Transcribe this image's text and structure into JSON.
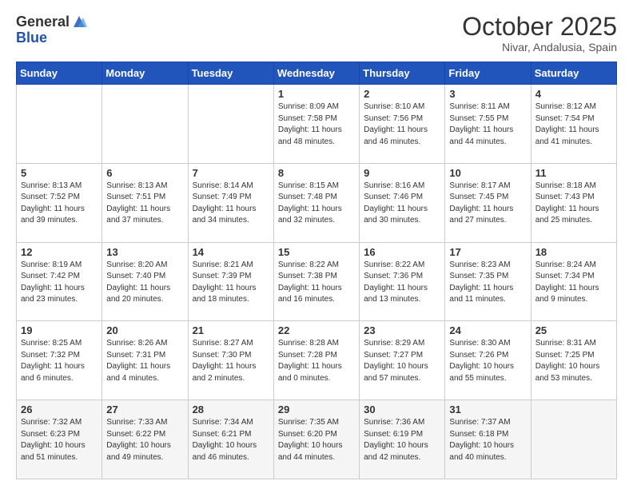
{
  "logo": {
    "general": "General",
    "blue": "Blue"
  },
  "title": "October 2025",
  "location": "Nivar, Andalusia, Spain",
  "days_of_week": [
    "Sunday",
    "Monday",
    "Tuesday",
    "Wednesday",
    "Thursday",
    "Friday",
    "Saturday"
  ],
  "weeks": [
    [
      {
        "day": "",
        "info": ""
      },
      {
        "day": "",
        "info": ""
      },
      {
        "day": "",
        "info": ""
      },
      {
        "day": "1",
        "info": "Sunrise: 8:09 AM\nSunset: 7:58 PM\nDaylight: 11 hours and 48 minutes."
      },
      {
        "day": "2",
        "info": "Sunrise: 8:10 AM\nSunset: 7:56 PM\nDaylight: 11 hours and 46 minutes."
      },
      {
        "day": "3",
        "info": "Sunrise: 8:11 AM\nSunset: 7:55 PM\nDaylight: 11 hours and 44 minutes."
      },
      {
        "day": "4",
        "info": "Sunrise: 8:12 AM\nSunset: 7:54 PM\nDaylight: 11 hours and 41 minutes."
      }
    ],
    [
      {
        "day": "5",
        "info": "Sunrise: 8:13 AM\nSunset: 7:52 PM\nDaylight: 11 hours and 39 minutes."
      },
      {
        "day": "6",
        "info": "Sunrise: 8:13 AM\nSunset: 7:51 PM\nDaylight: 11 hours and 37 minutes."
      },
      {
        "day": "7",
        "info": "Sunrise: 8:14 AM\nSunset: 7:49 PM\nDaylight: 11 hours and 34 minutes."
      },
      {
        "day": "8",
        "info": "Sunrise: 8:15 AM\nSunset: 7:48 PM\nDaylight: 11 hours and 32 minutes."
      },
      {
        "day": "9",
        "info": "Sunrise: 8:16 AM\nSunset: 7:46 PM\nDaylight: 11 hours and 30 minutes."
      },
      {
        "day": "10",
        "info": "Sunrise: 8:17 AM\nSunset: 7:45 PM\nDaylight: 11 hours and 27 minutes."
      },
      {
        "day": "11",
        "info": "Sunrise: 8:18 AM\nSunset: 7:43 PM\nDaylight: 11 hours and 25 minutes."
      }
    ],
    [
      {
        "day": "12",
        "info": "Sunrise: 8:19 AM\nSunset: 7:42 PM\nDaylight: 11 hours and 23 minutes."
      },
      {
        "day": "13",
        "info": "Sunrise: 8:20 AM\nSunset: 7:40 PM\nDaylight: 11 hours and 20 minutes."
      },
      {
        "day": "14",
        "info": "Sunrise: 8:21 AM\nSunset: 7:39 PM\nDaylight: 11 hours and 18 minutes."
      },
      {
        "day": "15",
        "info": "Sunrise: 8:22 AM\nSunset: 7:38 PM\nDaylight: 11 hours and 16 minutes."
      },
      {
        "day": "16",
        "info": "Sunrise: 8:22 AM\nSunset: 7:36 PM\nDaylight: 11 hours and 13 minutes."
      },
      {
        "day": "17",
        "info": "Sunrise: 8:23 AM\nSunset: 7:35 PM\nDaylight: 11 hours and 11 minutes."
      },
      {
        "day": "18",
        "info": "Sunrise: 8:24 AM\nSunset: 7:34 PM\nDaylight: 11 hours and 9 minutes."
      }
    ],
    [
      {
        "day": "19",
        "info": "Sunrise: 8:25 AM\nSunset: 7:32 PM\nDaylight: 11 hours and 6 minutes."
      },
      {
        "day": "20",
        "info": "Sunrise: 8:26 AM\nSunset: 7:31 PM\nDaylight: 11 hours and 4 minutes."
      },
      {
        "day": "21",
        "info": "Sunrise: 8:27 AM\nSunset: 7:30 PM\nDaylight: 11 hours and 2 minutes."
      },
      {
        "day": "22",
        "info": "Sunrise: 8:28 AM\nSunset: 7:28 PM\nDaylight: 11 hours and 0 minutes."
      },
      {
        "day": "23",
        "info": "Sunrise: 8:29 AM\nSunset: 7:27 PM\nDaylight: 10 hours and 57 minutes."
      },
      {
        "day": "24",
        "info": "Sunrise: 8:30 AM\nSunset: 7:26 PM\nDaylight: 10 hours and 55 minutes."
      },
      {
        "day": "25",
        "info": "Sunrise: 8:31 AM\nSunset: 7:25 PM\nDaylight: 10 hours and 53 minutes."
      }
    ],
    [
      {
        "day": "26",
        "info": "Sunrise: 7:32 AM\nSunset: 6:23 PM\nDaylight: 10 hours and 51 minutes."
      },
      {
        "day": "27",
        "info": "Sunrise: 7:33 AM\nSunset: 6:22 PM\nDaylight: 10 hours and 49 minutes."
      },
      {
        "day": "28",
        "info": "Sunrise: 7:34 AM\nSunset: 6:21 PM\nDaylight: 10 hours and 46 minutes."
      },
      {
        "day": "29",
        "info": "Sunrise: 7:35 AM\nSunset: 6:20 PM\nDaylight: 10 hours and 44 minutes."
      },
      {
        "day": "30",
        "info": "Sunrise: 7:36 AM\nSunset: 6:19 PM\nDaylight: 10 hours and 42 minutes."
      },
      {
        "day": "31",
        "info": "Sunrise: 7:37 AM\nSunset: 6:18 PM\nDaylight: 10 hours and 40 minutes."
      },
      {
        "day": "",
        "info": ""
      }
    ]
  ]
}
